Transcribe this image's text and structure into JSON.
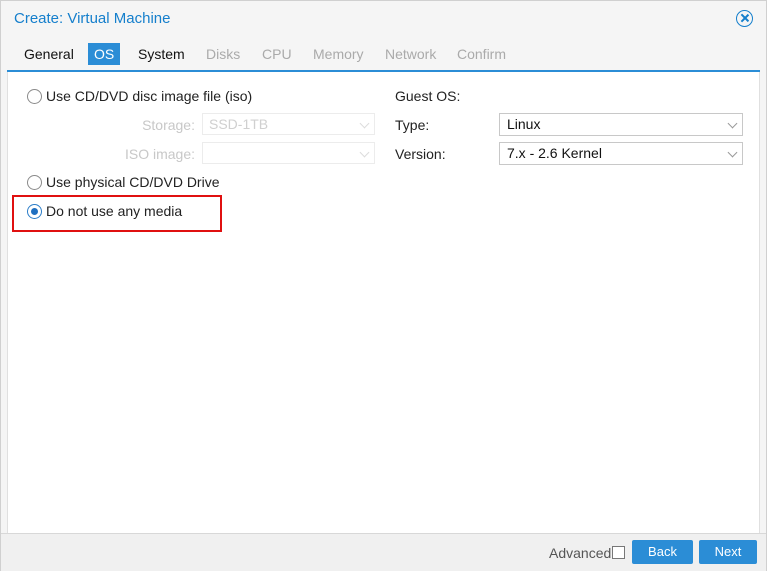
{
  "window": {
    "title": "Create: Virtual Machine"
  },
  "tabs": [
    {
      "label": "General",
      "state": "enabled"
    },
    {
      "label": "OS",
      "state": "active"
    },
    {
      "label": "System",
      "state": "enabled"
    },
    {
      "label": "Disks",
      "state": "disabled"
    },
    {
      "label": "CPU",
      "state": "disabled"
    },
    {
      "label": "Memory",
      "state": "disabled"
    },
    {
      "label": "Network",
      "state": "disabled"
    },
    {
      "label": "Confirm",
      "state": "disabled"
    }
  ],
  "media": {
    "option_iso": "Use CD/DVD disc image file (iso)",
    "storage_label": "Storage:",
    "storage_value": "SSD-1TB",
    "iso_label": "ISO image:",
    "iso_value": "",
    "option_physical": "Use physical CD/DVD Drive",
    "option_none": "Do not use any media",
    "selected": "option_none"
  },
  "guest_os": {
    "heading": "Guest OS:",
    "type_label": "Type:",
    "type_value": "Linux",
    "version_label": "Version:",
    "version_value": "7.x - 2.6 Kernel"
  },
  "footer": {
    "advanced_label": "Advanced",
    "advanced_checked": false,
    "back_label": "Back",
    "next_label": "Next"
  },
  "colors": {
    "accent": "#2b8dd6",
    "title": "#157fcc",
    "highlight": "#e01010"
  }
}
